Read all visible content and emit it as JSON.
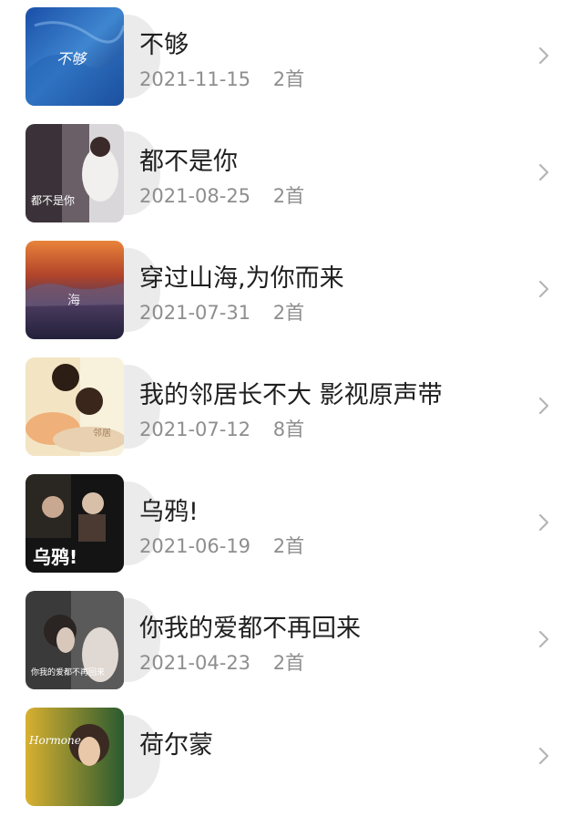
{
  "albums": [
    {
      "title": "不够",
      "date": "2021-11-15",
      "count": "2首",
      "cover_text": "不够"
    },
    {
      "title": "都不是你",
      "date": "2021-08-25",
      "count": "2首",
      "cover_text": "都不是你"
    },
    {
      "title": "穿过山海,为你而来",
      "date": "2021-07-31",
      "count": "2首",
      "cover_text": "海"
    },
    {
      "title": "我的邻居长不大 影视原声带",
      "date": "2021-07-12",
      "count": "8首",
      "cover_text": "邻居"
    },
    {
      "title": "乌鸦!",
      "date": "2021-06-19",
      "count": "2首",
      "cover_text": "乌鸦!"
    },
    {
      "title": "你我的爱都不再回来",
      "date": "2021-04-23",
      "count": "2首",
      "cover_text": "你我的爱都不再回来"
    },
    {
      "title": "荷尔蒙",
      "date": "",
      "count": "",
      "cover_text": "Hormone"
    }
  ],
  "icons": {
    "chevron": "chevron-right-icon"
  },
  "colors": {
    "title": "#1f1f1f",
    "meta": "#8e8e8e",
    "chevron": "#b5b5b5"
  }
}
